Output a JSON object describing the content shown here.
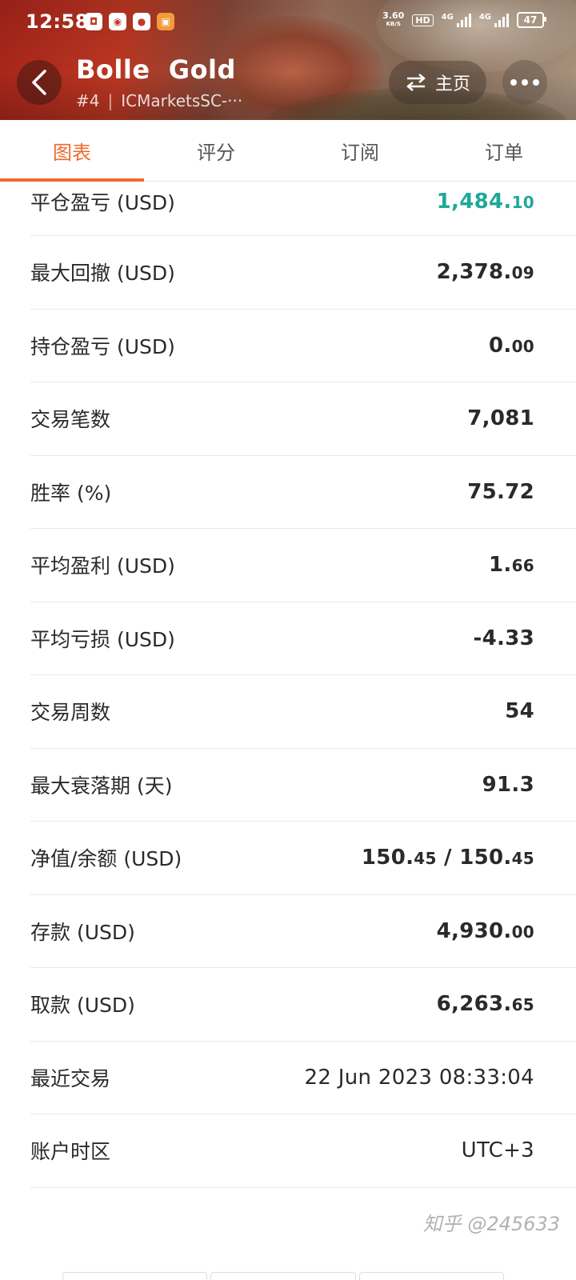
{
  "status_bar": {
    "time": "12:58",
    "net_speed": "3.60",
    "net_unit": "KB/S",
    "hd_label": "HD",
    "sim1_label": "4G",
    "sim2_label": "4G",
    "battery": "47"
  },
  "nav": {
    "title": "Bolle  Gold",
    "rank": "#4",
    "broker": "ICMarketsSC-···",
    "home_label": "主页"
  },
  "tabs": [
    {
      "label": "图表",
      "active": true
    },
    {
      "label": "评分",
      "active": false
    },
    {
      "label": "订阅",
      "active": false
    },
    {
      "label": "订单",
      "active": false
    }
  ],
  "stats": [
    {
      "label": "平仓盈亏 (USD)",
      "main": "1,484.",
      "decimals": "10",
      "positive": true
    },
    {
      "label": "最大回撤 (USD)",
      "main": "2,378.",
      "decimals": "09"
    },
    {
      "label": "持仓盈亏 (USD)",
      "main": "0.",
      "decimals": "00"
    },
    {
      "label": "交易笔数",
      "main": "7,081",
      "decimals": ""
    },
    {
      "label": "胜率 (%)",
      "main": "75.72",
      "decimals": ""
    },
    {
      "label": "平均盈利 (USD)",
      "main": "1.",
      "decimals": "66"
    },
    {
      "label": "平均亏损 (USD)",
      "main": "-4.33",
      "decimals": ""
    },
    {
      "label": "交易周数",
      "main": "54",
      "decimals": ""
    },
    {
      "label": "最大衰落期 (天)",
      "main": "91.3",
      "decimals": ""
    },
    {
      "label": "净值/余额 (USD)",
      "main": "150.",
      "decimals": "45",
      "main2": " / 150.",
      "decimals2": "45"
    },
    {
      "label": "存款 (USD)",
      "main": "4,930.",
      "decimals": "00"
    },
    {
      "label": "取款 (USD)",
      "main": "6,263.",
      "decimals": "65"
    },
    {
      "label": "最近交易",
      "main": "22 Jun 2023 08:33:04",
      "decimals": ""
    },
    {
      "label": "账户时区",
      "main": "UTC+3",
      "decimals": ""
    }
  ],
  "watermark": "知乎 @245633",
  "colors": {
    "accent": "#ef6a2e",
    "positive": "#1fa89a"
  }
}
